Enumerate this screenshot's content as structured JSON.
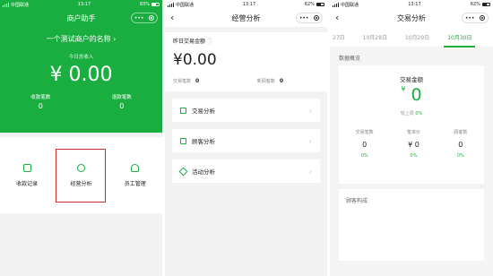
{
  "status": {
    "carrier": "中国联通",
    "time1": "13:17",
    "time": "13:17",
    "battery1": "83%",
    "battery": "62%"
  },
  "capsule": {
    "dots": "•••"
  },
  "screen1": {
    "title": "商户助手",
    "merchant": "一个测试商户的名称",
    "today_label": "今日总收入",
    "today_value": "¥ 0.00",
    "counts": [
      {
        "label": "收款笔数",
        "value": "0"
      },
      {
        "label": "退款笔数",
        "value": "0"
      }
    ],
    "tiles": [
      {
        "label": "收款记录",
        "icon": "receipt-icon"
      },
      {
        "label": "经营分析",
        "icon": "pie-chart-icon"
      },
      {
        "label": "员工管理",
        "icon": "person-icon"
      }
    ]
  },
  "screen2": {
    "title": "经营分析",
    "yesterday_label": "昨日交易金额",
    "amount": "¥0.00",
    "trade_count_label": "交易笔数",
    "trade_count": "0",
    "new_customers_label": "新顾客数",
    "new_customers": "0",
    "rows": [
      {
        "label": "交易分析"
      },
      {
        "label": "顾客分析"
      },
      {
        "label": "活动分析"
      }
    ]
  },
  "screen3": {
    "title": "交易分析",
    "tabs": [
      "27日",
      "10月28日",
      "10月29日",
      "10月30日"
    ],
    "active_tab": "10月30日",
    "overview_title": "数据概览",
    "amount_label": "交易金额",
    "amount_value": "0",
    "compare_label": "较上周",
    "compare_value": "0%",
    "stats": [
      {
        "label": "交易笔数",
        "value": "0",
        "pct": "0%"
      },
      {
        "label": "笔单价",
        "value": "¥ 0",
        "pct": "0%"
      },
      {
        "label": "顾客数",
        "value": "0",
        "pct": "0%"
      }
    ],
    "composition_title": "顾客构成"
  },
  "colors": {
    "accent": "#1aad3f",
    "highlight": "#c8302a"
  }
}
